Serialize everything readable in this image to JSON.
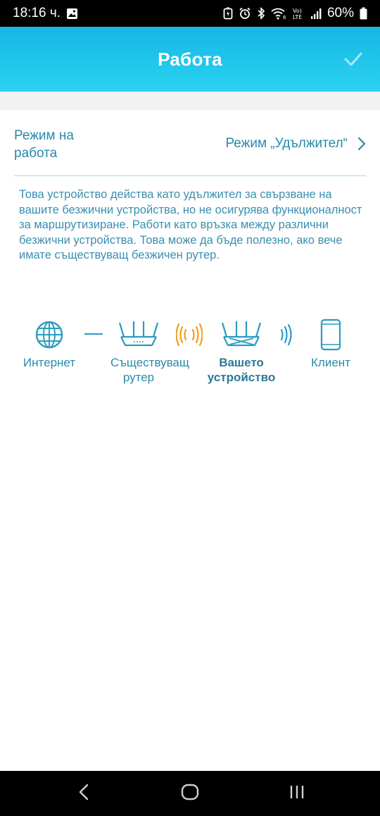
{
  "status_bar": {
    "time": "18:16 ч.",
    "battery": "60%",
    "icons": [
      "image-icon",
      "battery-saver-icon",
      "alarm-icon",
      "bluetooth-icon",
      "wifi-6-icon",
      "volte-icon",
      "signal-icon",
      "battery-icon"
    ],
    "volte_text": "Vo)\nLTE"
  },
  "header": {
    "title": "Работа",
    "confirm_icon": "check-icon"
  },
  "mode_row": {
    "label": "Режим на работа",
    "value": "Режим „Удължител“",
    "chevron_icon": "chevron-right-icon"
  },
  "description": "Това устройство действа като удължител за свързване на вашите безжични устройства, но не осигурява функционалност за маршрутизиране. Работи като връзка между различни безжични устройства. Това може да бъде полезно, ако вече имате съществуващ безжичен рутер.",
  "diagram": {
    "internet": {
      "label": "Интернет",
      "icon": "globe-icon"
    },
    "existing_router": {
      "label": "Съществуващ рутер",
      "icon": "router-icon"
    },
    "your_device": {
      "label": "Вашето устройство",
      "icon": "extender-icon"
    },
    "client": {
      "label": "Клиент",
      "icon": "phone-icon"
    },
    "link_wired": "dash-line",
    "link_wireless_orange": "wifi-waves-icon",
    "link_wireless_blue": "wifi-waves-icon",
    "colors": {
      "blue": "#2a9cc0",
      "orange": "#f0a020"
    }
  },
  "nav_bar": {
    "back_icon": "back-icon",
    "home_icon": "home-icon",
    "recents_icon": "recents-icon"
  }
}
